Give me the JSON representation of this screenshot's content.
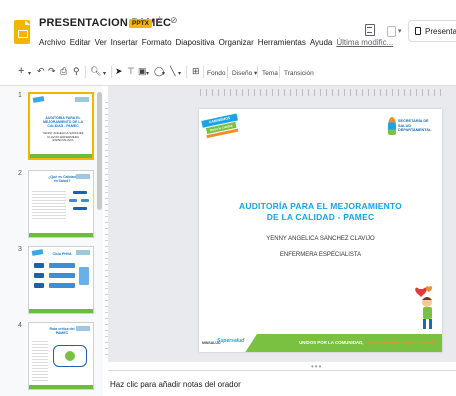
{
  "app": {
    "title": "PRESENTACION PAMEC",
    "badge": "PPTX",
    "star_icon": "star-icon",
    "cloud_icon": "cloud-status-icon"
  },
  "menu": [
    "Archivo",
    "Editar",
    "Ver",
    "Insertar",
    "Formato",
    "Diapositiva",
    "Organizar",
    "Herramientas",
    "Ayuda"
  ],
  "last_edit": "Última modific...",
  "present_label": "Presentar",
  "toolbar": {
    "background": "Fondo",
    "layout": "Diseño ▾",
    "theme": "Tema",
    "transition": "Transición"
  },
  "slides": [
    {
      "number": "1",
      "title": "AUDITORÍA PARA EL MEJORAMIENTO DE LA CALIDAD - PAMEC",
      "sub": "YENNY ANGELICA SANCHEZ CLAVIJO ENFERMERA ESPECIALISTA"
    },
    {
      "number": "2",
      "title": "¿Qué es Calidad en Salud?",
      "sub": ""
    },
    {
      "number": "3",
      "title": "Ciclo PHVA",
      "sub": ""
    },
    {
      "number": "4",
      "title": "Ruta crítica del PAMEC",
      "sub": ""
    }
  ],
  "slide": {
    "banner_top": "CAMINEMOS JUNTOS",
    "banner_bottom": "Hacia la Calidad",
    "logo_text": "SECRETARÍA DE SALUD DEPARTAMENTAL",
    "title": "AUDITORÍA PARA EL MEJORAMIENTO DE LA CALIDAD - PAMEC",
    "name": "YENNY ANGELICA SANCHEZ CLAVIJO",
    "role": "ENFERMERA ESPECIALISTA",
    "footer_ministry": "MINSALUD",
    "footer_supersalud": "Supersalud",
    "slogan_part1": "UNIDOS POR LA COMUNIDAD, ",
    "slogan_part2": "CON HUMANIZACIÓN Y CALIDAD"
  },
  "notes_placeholder": "Haz clic para añadir notas del orador",
  "colors": {
    "accent": "#F4B400",
    "slide_title": "#1AA3E8",
    "footer_green": "#7AC142",
    "slogan_orange": "#F28C28"
  }
}
